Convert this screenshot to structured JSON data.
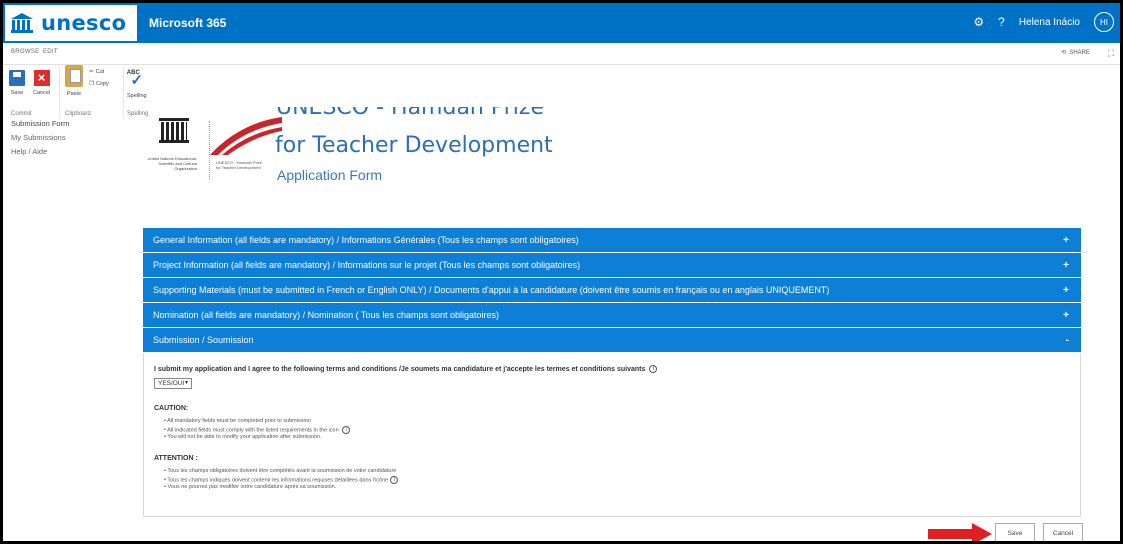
{
  "suite": {
    "logo_text": "unesco",
    "title": "Microsoft 365",
    "settings_icon": "gear-icon",
    "help_label": "?",
    "user_name": "Helena Inácio",
    "user_initials": "HI"
  },
  "ribbon_tabs": {
    "browse": "BROWSE",
    "edit": "EDIT",
    "share": "SHARE"
  },
  "ribbon": {
    "save": "Save",
    "cancel": "Cancel",
    "paste": "Paste",
    "cut": "Cut",
    "copy": "Copy",
    "spelling": "Spelling",
    "spell_abc": "ABC",
    "group_commit": "Commit",
    "group_clipboard": "Clipboard",
    "group_spelling": "Spelling"
  },
  "nav": {
    "items": [
      "Submission Form",
      "My Submissions",
      "Help / Aide"
    ]
  },
  "header": {
    "un_text": "United Nations Educational, Scientific and Cultural Organization",
    "prize_small": "UNESCO - Hamdan Prize for Teacher Development",
    "title_top": "UNESCO - Hamdan Prize",
    "title_main": "for Teacher Development",
    "subtitle": "Application Form"
  },
  "accordion": [
    {
      "label": "General Information (all fields are mandatory) / Informations Générales (Tous les champs sont obligatoires)",
      "sign": "+"
    },
    {
      "label": "Project Information (all fields are mandatory) / Informations sur le projet (Tous les champs sont obligatoires)",
      "sign": "+"
    },
    {
      "label": "Supporting Materials (must be submitted in French or English ONLY) / Documents d'appui à la candidature (doivent être soumis en français ou en anglais UNIQUEMENT)",
      "sign": "+"
    },
    {
      "label": "Nomination (all fields are mandatory) / Nomination ( Tous les champs sont obligatoires)",
      "sign": "+"
    },
    {
      "label": "Submission / Soumission",
      "sign": "-"
    }
  ],
  "submission": {
    "terms": "I submit my application and I agree to the following terms and conditions /Je soumets ma candidature et j'accepte les termes et conditions suivants",
    "select_value": "YES/OUI",
    "caution_title": "CAUTION:",
    "caution_items": [
      "All mandatory fields must be completed prior to submission",
      "All indicated fields must comply with the listed requirements in the icon",
      "You will not be able to modify your application after submission."
    ],
    "attention_title": "ATTENTION :",
    "attention_items": [
      "Tous les champs obligatoires doivent être complétés avant la soumission de votre candidature",
      "Tous les champs indiqués doivent contenir les informations requises détaillées dans l'icône",
      "Vous ne pourrez pas modifier votre candidature après sa soumission."
    ]
  },
  "buttons": {
    "save": "Save",
    "cancel": "Cancel"
  },
  "colors": {
    "brand": "#0072c6",
    "accordion": "#0e7fd6",
    "arrow": "#e02020"
  }
}
